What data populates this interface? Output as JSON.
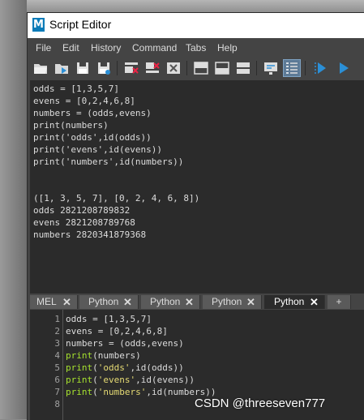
{
  "window": {
    "title": "Script Editor",
    "app_icon_letter": "M",
    "accent": "#0a7bb8"
  },
  "menu": [
    "File",
    "Edit",
    "History",
    "Command",
    "Tabs",
    "Help"
  ],
  "toolbar": {
    "icons": [
      "open-script-icon",
      "source-script-icon",
      "save-script-icon",
      "save-script-to-shelf-icon",
      "clear-history-icon",
      "clear-input-icon",
      "clear-all-icon",
      "show-history-icon",
      "show-input-icon",
      "show-both-icon",
      "echo-all-commands-icon",
      "show-line-numbers-icon",
      "execute-all-icon",
      "execute-icon"
    ]
  },
  "output": {
    "lines": [
      "odds = [1,3,5,7]",
      "evens = [0,2,4,6,8]",
      "numbers = (odds,evens)",
      "print(numbers)",
      "print('odds',id(odds))",
      "print('evens',id(evens))",
      "print('numbers',id(numbers))",
      "",
      "",
      "([1, 3, 5, 7], [0, 2, 4, 6, 8])",
      "odds 2821208789832",
      "evens 2821208789768",
      "numbers 2820341879368"
    ]
  },
  "tabs": [
    {
      "label": "MEL",
      "active": false
    },
    {
      "label": "Python",
      "active": false
    },
    {
      "label": "Python",
      "active": false
    },
    {
      "label": "Python",
      "active": false
    },
    {
      "label": "Python",
      "active": true
    }
  ],
  "add_tab_label": "+",
  "editor": {
    "line_numbers": [
      "1",
      "2",
      "3",
      "4",
      "5",
      "6",
      "7",
      "8"
    ],
    "lines": [
      [
        {
          "t": "odds = [1,3,5,7]",
          "c": "plain"
        }
      ],
      [
        {
          "t": "evens = [0,2,4,6,8]",
          "c": "plain"
        }
      ],
      [
        {
          "t": "numbers = (odds,evens)",
          "c": "plain"
        }
      ],
      [
        {
          "t": "print",
          "c": "kw"
        },
        {
          "t": "(numbers)",
          "c": "plain"
        }
      ],
      [
        {
          "t": "print",
          "c": "kw"
        },
        {
          "t": "(",
          "c": "plain"
        },
        {
          "t": "'odds'",
          "c": "str"
        },
        {
          "t": ",id(odds))",
          "c": "plain"
        }
      ],
      [
        {
          "t": "print",
          "c": "kw"
        },
        {
          "t": "(",
          "c": "plain"
        },
        {
          "t": "'evens'",
          "c": "str"
        },
        {
          "t": ",id(evens))",
          "c": "plain"
        }
      ],
      [
        {
          "t": "print",
          "c": "kw"
        },
        {
          "t": "(",
          "c": "plain"
        },
        {
          "t": "'numbers'",
          "c": "str"
        },
        {
          "t": ",id(numbers))",
          "c": "plain"
        }
      ],
      []
    ]
  },
  "watermark": "CSDN @threeseven777"
}
